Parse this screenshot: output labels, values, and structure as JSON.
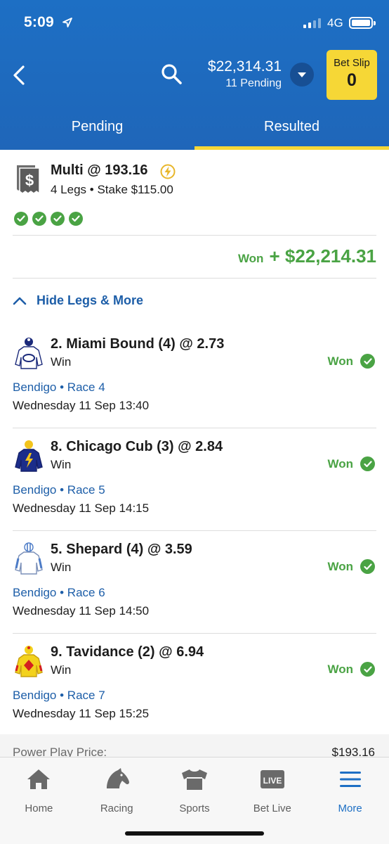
{
  "status_bar": {
    "time": "5:09",
    "network": "4G"
  },
  "header": {
    "balance": "$22,314.31",
    "pending": "11 Pending",
    "bet_slip_label": "Bet Slip",
    "bet_slip_count": "0"
  },
  "tabs": [
    {
      "label": "Pending",
      "active": false
    },
    {
      "label": "Resulted",
      "active": true
    }
  ],
  "bet": {
    "title": "Multi @ 193.16",
    "subtitle": "4 Legs • Stake $115.00",
    "won_label": "Won",
    "won_amount": "+ $22,214.31",
    "toggle_label": "Hide Legs & More"
  },
  "legs": [
    {
      "title": "2. Miami Bound (4) @ 2.73",
      "type": "Win",
      "result": "Won",
      "race": "Bendigo • Race 4",
      "date": "Wednesday 11 Sep 13:40"
    },
    {
      "title": "8. Chicago Cub (3) @ 2.84",
      "type": "Win",
      "result": "Won",
      "race": "Bendigo • Race 5",
      "date": "Wednesday 11 Sep 14:15"
    },
    {
      "title": "5. Shepard (4) @ 3.59",
      "type": "Win",
      "result": "Won",
      "race": "Bendigo • Race 6",
      "date": "Wednesday 11 Sep 14:50"
    },
    {
      "title": "9. Tavidance (2) @ 6.94",
      "type": "Win",
      "result": "Won",
      "race": "Bendigo • Race 7",
      "date": "Wednesday 11 Sep 15:25"
    }
  ],
  "power_play": {
    "label": "Power Play Price:",
    "value": "$193.16"
  },
  "nav": [
    {
      "label": "Home",
      "icon": "home-icon"
    },
    {
      "label": "Racing",
      "icon": "horse-head-icon"
    },
    {
      "label": "Sports",
      "icon": "jersey-icon"
    },
    {
      "label": "Bet Live",
      "icon": "live-icon",
      "badge": "LIVE"
    },
    {
      "label": "More",
      "icon": "menu-icon",
      "active": true
    }
  ],
  "colors": {
    "brand_blue": "#1d6fc4",
    "accent_yellow": "#f6d736",
    "won_green": "#4aa344",
    "link_blue": "#1d5ea8"
  }
}
